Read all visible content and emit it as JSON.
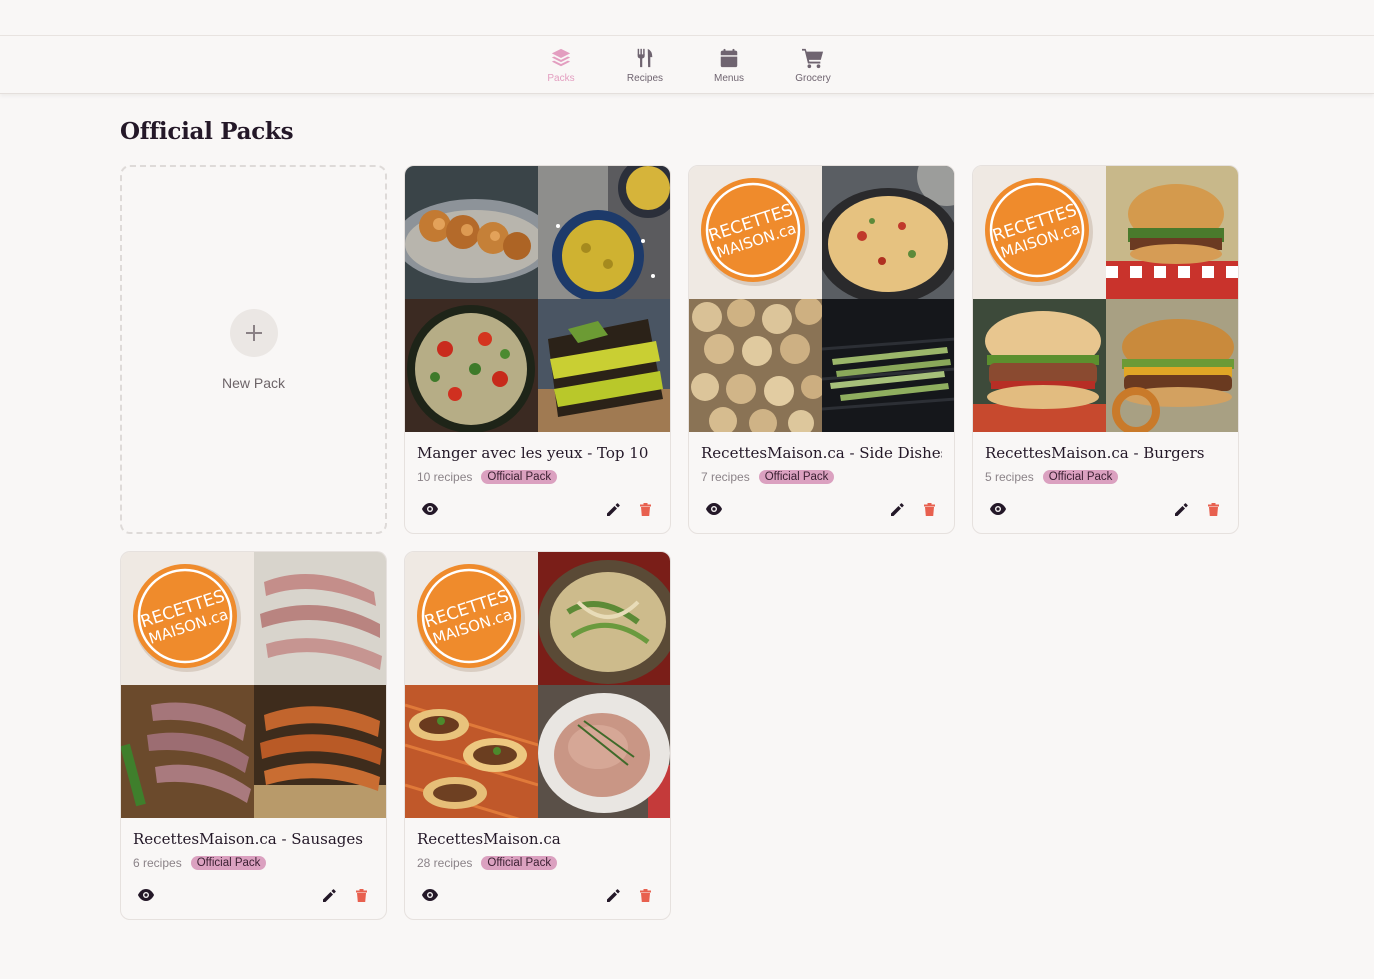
{
  "nav": {
    "items": [
      {
        "label": "Packs",
        "icon": "layers-icon",
        "active": true
      },
      {
        "label": "Recipes",
        "icon": "utensils-icon",
        "active": false
      },
      {
        "label": "Menus",
        "icon": "calendar-icon",
        "active": false
      },
      {
        "label": "Grocery",
        "icon": "cart-icon",
        "active": false
      }
    ],
    "active_color": "#e39ec0"
  },
  "page": {
    "title": "Official Packs"
  },
  "new_pack": {
    "label": "New Pack",
    "icon": "plus-icon"
  },
  "packs": [
    {
      "title": "Manger avec les yeux - Top 10",
      "count": "10 recipes",
      "badge": "Official Pack"
    },
    {
      "title": "RecettesMaison.ca - Side Dishes",
      "count": "7 recipes",
      "badge": "Official Pack",
      "logo_text": [
        "RECETTES",
        "MAISON.ca"
      ]
    },
    {
      "title": "RecettesMaison.ca - Burgers",
      "count": "5 recipes",
      "badge": "Official Pack",
      "logo_text": [
        "RECETTES",
        "MAISON.ca"
      ]
    },
    {
      "title": "RecettesMaison.ca - Sausages",
      "count": "6 recipes",
      "badge": "Official Pack",
      "logo_text": [
        "RECETTES",
        "MAISON.ca"
      ]
    },
    {
      "title": "RecettesMaison.ca",
      "count": "28 recipes",
      "badge": "Official Pack",
      "logo_text": [
        "RECETTES",
        "MAISON.ca"
      ]
    }
  ],
  "colors": {
    "badge": "#dba1c0",
    "delete": "#e8604f",
    "logo_orange": "#ef8b2c"
  }
}
